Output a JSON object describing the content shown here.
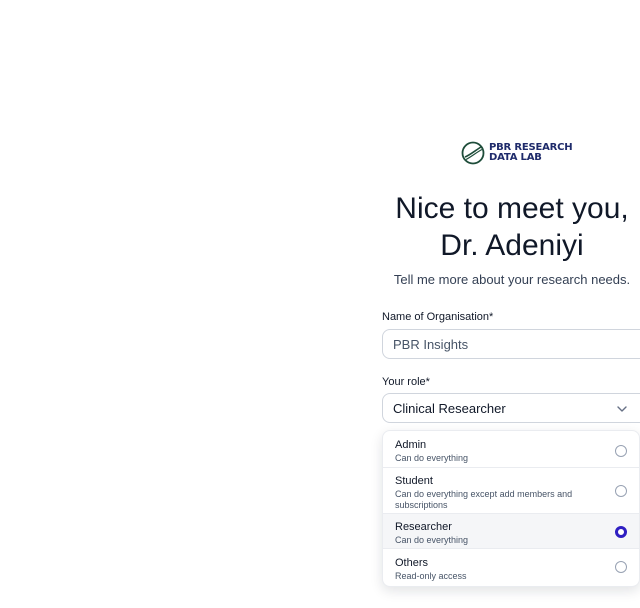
{
  "brand": {
    "line1": "PBR RESEARCH",
    "line2": "DATA LAB",
    "color": "#1f2b6b"
  },
  "heading": {
    "line1": "Nice to meet you,",
    "line2": "Dr. Adeniyi",
    "subtitle": "Tell me more about your research needs."
  },
  "form": {
    "org_label": "Name of Organisation*",
    "org_value": "PBR Insights",
    "role_label": "Your role*",
    "role_value": "Clinical Researcher"
  },
  "role_options": [
    {
      "title": "Admin",
      "description": "Can do everything",
      "selected": false
    },
    {
      "title": "Student",
      "description": "Can do everything except add members and subscriptions",
      "selected": false
    },
    {
      "title": "Researcher",
      "description": "Can do everything",
      "selected": true
    },
    {
      "title": "Others",
      "description": "Read-only access",
      "selected": false
    }
  ],
  "colors": {
    "accent": "#2f1fc2",
    "border": "#d0d5dd"
  }
}
